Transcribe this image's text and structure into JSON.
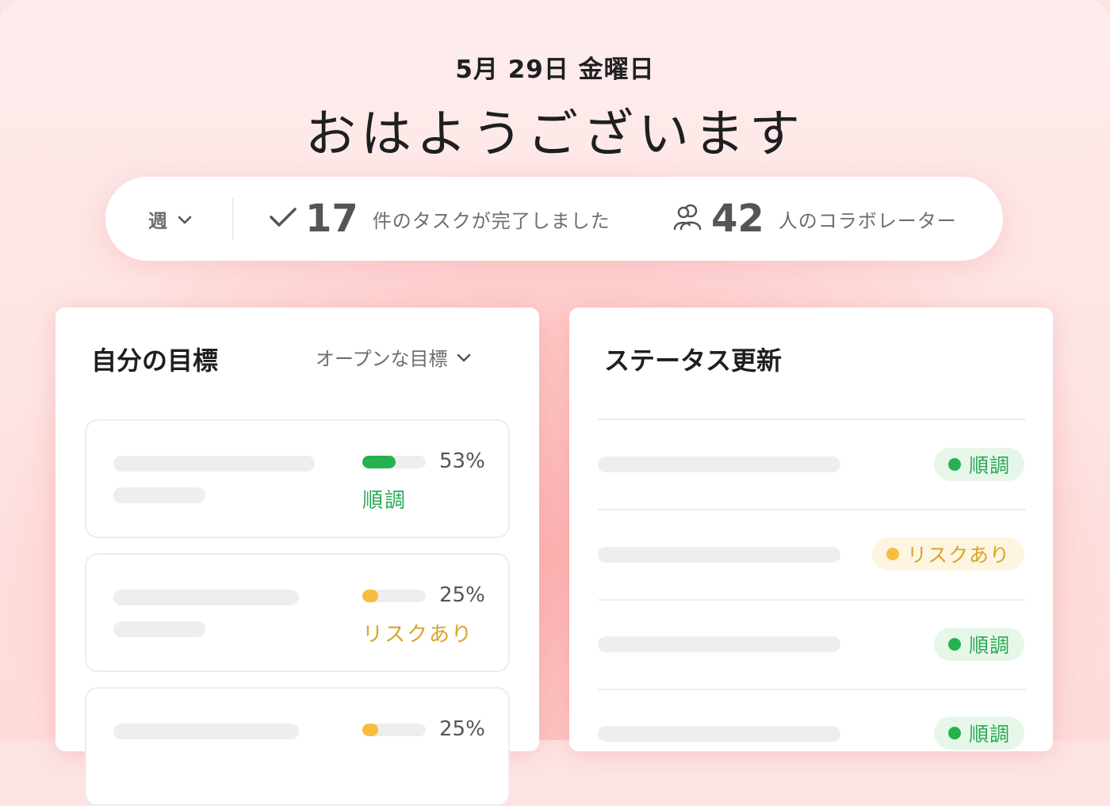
{
  "header": {
    "date": "5月 29日 金曜日",
    "greeting": "おはようございます"
  },
  "stats": {
    "period": "週",
    "tasks_count": "17",
    "tasks_label": "件のタスクが完了しました",
    "collab_count": "42",
    "collab_label": "人のコラボレーター"
  },
  "goals": {
    "title": "自分の目標",
    "filter": "オープンな目標",
    "items": [
      {
        "progress": 0.53,
        "percent": "53%",
        "status": "順調",
        "color": "#25b14f"
      },
      {
        "progress": 0.25,
        "percent": "25%",
        "status": "リスクあり",
        "color": "#f6bd3f"
      },
      {
        "progress": 0.25,
        "percent": "25%",
        "status": "",
        "color": "#f6bd3f"
      }
    ]
  },
  "updates": {
    "title": "ステータス更新",
    "items": [
      {
        "status": "順調",
        "color": "#25b14f"
      },
      {
        "status": "リスクあり",
        "color": "#f6bd3f"
      },
      {
        "status": "順調",
        "color": "#25b14f"
      },
      {
        "status": "順調",
        "color": "#25b14f"
      }
    ]
  },
  "colors": {
    "on_track": "#25b14f",
    "at_risk": "#f6bd3f",
    "on_track_text": "#2aa852",
    "at_risk_text": "#d9a526"
  },
  "icons": [
    "chevron-down-icon",
    "checkmark-icon",
    "people-icon"
  ]
}
